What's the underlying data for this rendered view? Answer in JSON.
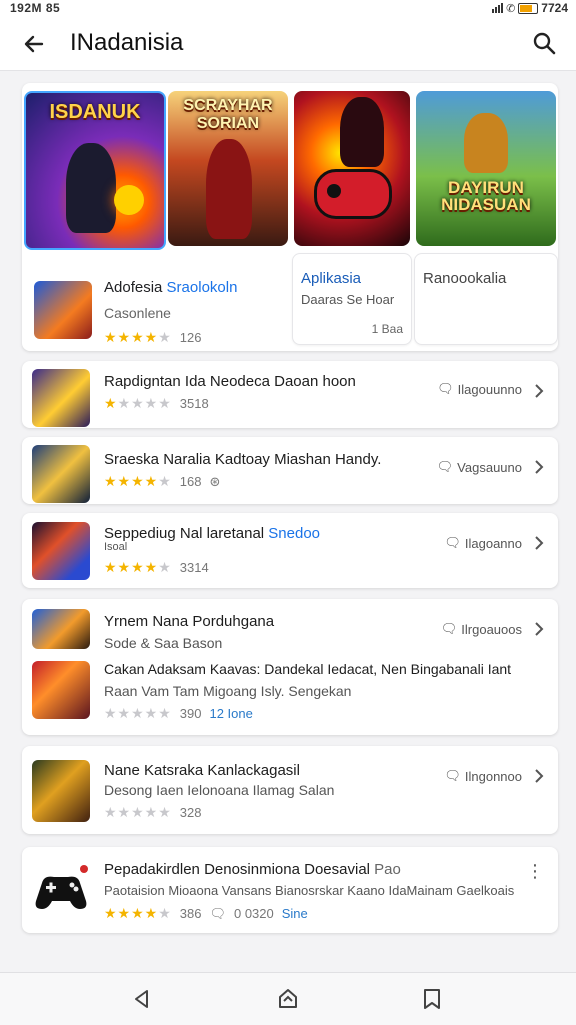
{
  "status": {
    "time": "192M 85",
    "right_text": "7724"
  },
  "header": {
    "title": "INadanisia",
    "back_icon": "arrow-left-icon",
    "search_icon": "search-icon"
  },
  "featured": {
    "banners": [
      {
        "title": "ISDANUK"
      },
      {
        "title": "SCRAYHAR SORIAN"
      },
      {
        "title": ""
      },
      {
        "title": "DAYIRUN NIDASUAN"
      }
    ],
    "main": {
      "name": "Adofesia",
      "name_accent": "Sraolokoln",
      "subtitle": "Casonlene",
      "rating": "126",
      "stars_on": 4
    },
    "mini1": {
      "name": "Aplikasia",
      "subtitle": "Daaras Se Hoar",
      "count": "1 Baa"
    },
    "mini2": {
      "name": "Ranoookalia"
    }
  },
  "list": [
    {
      "title": "Rapdigntan Ida Neodeca Daoan hoon",
      "rating": "3518",
      "stars_on": 1,
      "tag": "Ilagouunno"
    },
    {
      "title": "Sraeska Naralia Kadtoay Miashan Handy.",
      "rating": "168",
      "stars_on": 4,
      "tag": "Vagsauuno"
    },
    {
      "title": "Seppediug Nal laretanal",
      "title_accent": "Snedoo",
      "subtitle": "Isoal",
      "rating": "3314",
      "stars_on": 4,
      "tag": "Ilagoanno"
    },
    {
      "title": "Yrnem Nana Porduhgana",
      "subtitle": "Sode & Saa Bason",
      "tag": "Ilrgoauoos",
      "extra_title": "Cakan Adaksam Kaavas: Dandekal Iedacat, Nen Bingabanali Iant",
      "extra_subtitle": "Raan Vam Tam Migoang Isly. Sengekan",
      "rating": "390",
      "rating_extra": "12 Ione",
      "stars_on": 0
    },
    {
      "title": "Nane Katsraka Kanlackagasil",
      "subtitle": "Desong Iaen Ielonoana Ilamag Salan",
      "rating": "328",
      "stars_on": 0,
      "tag": "Ilngonnoo"
    },
    {
      "title": "Pepadakirdlen Denosinmiona Doesavial",
      "title_tail": "Pao",
      "subtitle": "Paotaision Mioaona Vansans Bianosrskar Kaano IdaMainam Gaelkoais",
      "rating": "386",
      "comments": "0 0320",
      "extra": "Sine",
      "stars_on": 4
    }
  ],
  "navbar": {
    "items": [
      "back-triangle-icon",
      "home-icon",
      "recents-icon"
    ]
  },
  "colors": {
    "accent": "#1a73e8",
    "star": "#f4b400",
    "background": "#f3f3f5"
  }
}
